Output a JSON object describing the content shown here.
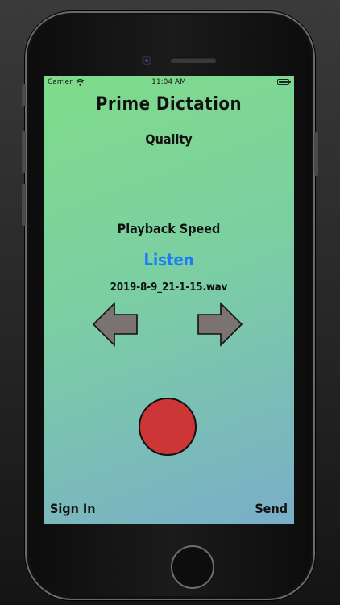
{
  "status_bar": {
    "carrier": "Carrier",
    "time": "11:04 AM",
    "wifi_icon": "wifi-icon",
    "battery_icon": "battery-icon",
    "battery_level": 1.0
  },
  "app": {
    "title": "Prime Dictation",
    "quality_label": "Quality",
    "playback_speed_label": "Playback Speed",
    "listen_label": "Listen",
    "current_file": "2019-8-9_21-1-15.wav"
  },
  "controls": {
    "previous_icon": "arrow-left-icon",
    "next_icon": "arrow-right-icon",
    "record_icon": "record-button"
  },
  "footer": {
    "sign_in_label": "Sign In",
    "send_label": "Send"
  },
  "colors": {
    "gradient_start": "#7fdc8a",
    "gradient_end": "#7aaec9",
    "listen_blue": "#1a7cf6",
    "record_red": "#cc3636",
    "arrow_gray": "#7a7372"
  }
}
